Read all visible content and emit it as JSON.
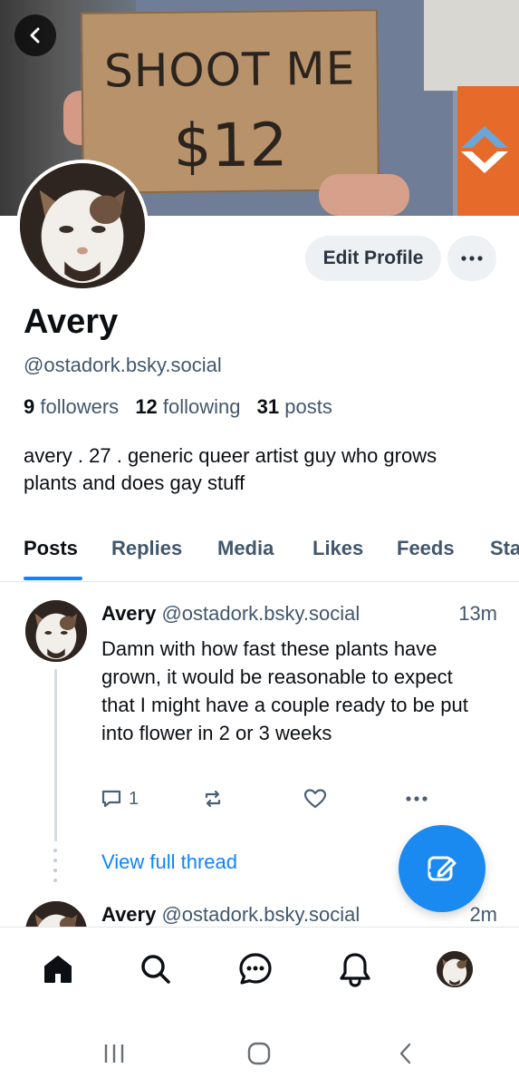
{
  "banner": {
    "sign_line1": "SHOOT ME",
    "sign_line2": "$12",
    "back_icon": "chevron-left-icon"
  },
  "profile": {
    "display_name": "Avery",
    "handle": "@ostadork.bsky.social",
    "edit_label": "Edit Profile",
    "more_icon": "ellipsis-icon",
    "followers_count": "9",
    "followers_label": "followers",
    "following_count": "12",
    "following_label": "following",
    "posts_count": "31",
    "posts_label": "posts",
    "bio": "avery . 27 .  generic queer artist guy who grows plants and does gay stuff"
  },
  "tabs": [
    {
      "label": "Posts",
      "active": true
    },
    {
      "label": "Replies"
    },
    {
      "label": "Media"
    },
    {
      "label": "Likes"
    },
    {
      "label": "Feeds"
    },
    {
      "label": "Sta"
    }
  ],
  "posts": [
    {
      "name": "Avery",
      "handle": "@ostadork.bsky.social",
      "time": "13m",
      "text": "Damn with how fast these plants have grown, it would be reasonable to expect that I might have a couple ready to be put into flower in 2 or 3 weeks",
      "reply_count": "1",
      "view_thread": "View full thread"
    },
    {
      "name": "Avery",
      "handle": "@ostadork.bsky.social",
      "time": "2m"
    }
  ],
  "colors": {
    "accent": "#1083fe",
    "fab": "#1b8af0",
    "muted": "#42576c"
  },
  "bottom_nav": [
    "home-icon",
    "search-icon",
    "chat-icon",
    "bell-icon",
    "profile-avatar"
  ],
  "system_nav": [
    "recents-icon",
    "home-circle-icon",
    "back-icon"
  ]
}
